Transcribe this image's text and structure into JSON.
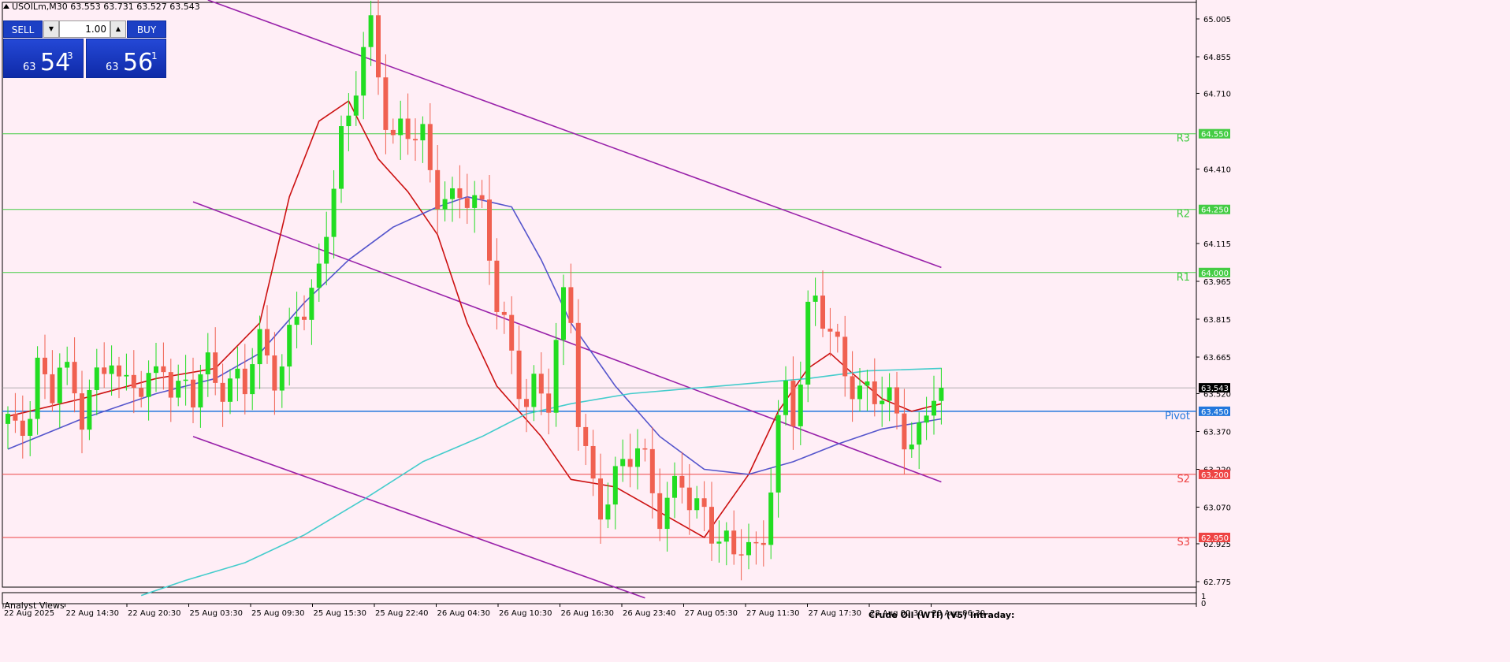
{
  "header": {
    "symbol": "USOILm",
    "timeframe": "M30",
    "title": "USOILm,M30  63.553 63.731 63.527 63.543"
  },
  "trade_panel": {
    "sell_label": "SELL",
    "buy_label": "BUY",
    "lot": "1.00",
    "sell_price": {
      "big": "63",
      "main": "54",
      "pip": "3"
    },
    "buy_price": {
      "big": "63",
      "main": "56",
      "pip": "1"
    }
  },
  "subwindow": {
    "label": ".Analyst Views",
    "title": "Crude Oil (WTI) (V5) Intraday:",
    "scale_top": "1",
    "scale_bottom": "0"
  },
  "colors": {
    "background": "#ffeef6",
    "bull": "#22dd22",
    "bear": "#f06050",
    "resistance": "#44cc44",
    "support": "#ee4444",
    "pivot": "#2277dd",
    "ma_fast": "#cc1111",
    "ma_mid": "#5555cc",
    "ma_slow": "#44cccc",
    "channel": "#9922aa"
  },
  "chart_data": {
    "type": "candlestick",
    "symbol": "USOILm",
    "timeframe": "M30",
    "ylim": [
      62.7,
      65.08
    ],
    "y_ticks": [
      65.005,
      64.855,
      64.71,
      64.41,
      64.115,
      63.965,
      63.815,
      63.665,
      63.52,
      63.37,
      63.22,
      63.07,
      62.925,
      62.775
    ],
    "x_ticks": [
      "22 Aug 2025",
      "22 Aug 14:30",
      "22 Aug 20:30",
      "25 Aug 03:30",
      "25 Aug 09:30",
      "25 Aug 15:30",
      "25 Aug 22:40",
      "26 Aug 04:30",
      "26 Aug 10:30",
      "26 Aug 16:30",
      "26 Aug 23:40",
      "27 Aug 05:30",
      "27 Aug 11:30",
      "27 Aug 17:30",
      "28 Aug 00:30",
      "28 Aug 06:30"
    ],
    "levels": [
      {
        "name": "R3",
        "value": 64.55,
        "label": "64.550"
      },
      {
        "name": "R2",
        "value": 64.25,
        "label": "64.250"
      },
      {
        "name": "R1",
        "value": 64.0,
        "label": "64.000"
      },
      {
        "name": "Pivot",
        "value": 63.45,
        "label": "63.450"
      },
      {
        "name": "S2",
        "value": 63.2,
        "label": "63.200"
      },
      {
        "name": "S3",
        "value": 62.95,
        "label": "62.950"
      }
    ],
    "current_price": 63.543,
    "current_price_label": "63.543",
    "anchors": [
      63.4,
      63.3,
      63.48,
      63.7,
      63.45,
      63.62,
      63.55,
      63.45,
      63.6,
      63.55,
      63.65,
      63.5,
      63.62,
      63.58,
      63.55,
      63.62,
      63.45,
      63.62,
      63.55,
      63.62,
      63.55,
      63.5,
      63.62,
      63.6,
      63.72,
      63.62,
      63.55,
      63.75,
      63.9,
      63.85,
      63.95,
      64.25,
      64.55,
      64.65,
      64.85,
      64.92,
      64.7,
      64.55,
      64.6,
      64.55,
      64.5,
      64.3,
      64.35,
      64.3,
      64.3,
      64.25,
      64.2,
      63.95,
      63.8,
      63.55,
      63.45,
      63.55,
      63.5,
      63.8,
      63.95,
      63.4,
      63.2,
      63.1,
      63.15,
      63.2,
      63.25,
      63.3,
      63.2,
      63.05,
      63.1,
      63.15,
      63.05,
      63.1,
      63.0,
      62.9,
      62.85,
      62.95,
      62.9,
      63.0,
      63.3,
      63.5,
      63.4,
      63.85,
      63.95,
      63.75,
      63.65,
      63.58,
      63.55,
      63.56,
      63.5,
      63.45,
      63.4,
      63.35,
      63.38,
      63.5,
      63.543
    ],
    "moving_averages": [
      {
        "color": "#cc1111",
        "points": [
          [
            0,
            63.43
          ],
          [
            10,
            63.5
          ],
          [
            20,
            63.58
          ],
          [
            28,
            63.62
          ],
          [
            34,
            63.8
          ],
          [
            38,
            64.3
          ],
          [
            42,
            64.6
          ],
          [
            46,
            64.68
          ],
          [
            50,
            64.45
          ],
          [
            54,
            64.32
          ],
          [
            58,
            64.15
          ],
          [
            62,
            63.8
          ],
          [
            66,
            63.55
          ],
          [
            72,
            63.35
          ],
          [
            76,
            63.18
          ],
          [
            82,
            63.15
          ],
          [
            88,
            63.05
          ],
          [
            94,
            62.95
          ],
          [
            100,
            63.2
          ],
          [
            104,
            63.45
          ],
          [
            108,
            63.62
          ],
          [
            111,
            63.68
          ],
          [
            114,
            63.6
          ],
          [
            118,
            63.5
          ],
          [
            122,
            63.45
          ],
          [
            126,
            63.48
          ]
        ]
      },
      {
        "color": "#5555cc",
        "points": [
          [
            0,
            63.3
          ],
          [
            10,
            63.42
          ],
          [
            20,
            63.52
          ],
          [
            28,
            63.58
          ],
          [
            34,
            63.68
          ],
          [
            40,
            63.88
          ],
          [
            46,
            64.05
          ],
          [
            52,
            64.18
          ],
          [
            58,
            64.26
          ],
          [
            62,
            64.3
          ],
          [
            68,
            64.26
          ],
          [
            72,
            64.05
          ],
          [
            76,
            63.8
          ],
          [
            82,
            63.55
          ],
          [
            88,
            63.35
          ],
          [
            94,
            63.22
          ],
          [
            100,
            63.2
          ],
          [
            106,
            63.25
          ],
          [
            112,
            63.32
          ],
          [
            118,
            63.38
          ],
          [
            126,
            63.42
          ]
        ]
      },
      {
        "color": "#44cccc",
        "points": [
          [
            18,
            62.72
          ],
          [
            24,
            62.78
          ],
          [
            32,
            62.85
          ],
          [
            40,
            62.96
          ],
          [
            48,
            63.1
          ],
          [
            56,
            63.25
          ],
          [
            64,
            63.35
          ],
          [
            70,
            63.44
          ],
          [
            76,
            63.48
          ],
          [
            84,
            63.52
          ],
          [
            92,
            63.54
          ],
          [
            100,
            63.56
          ],
          [
            108,
            63.58
          ],
          [
            116,
            63.61
          ],
          [
            126,
            63.62
          ]
        ]
      }
    ],
    "channel_lines": [
      {
        "from": [
          27,
          65.08
        ],
        "to": [
          126,
          64.02
        ]
      },
      {
        "from": [
          25,
          64.28
        ],
        "to": [
          126,
          63.17
        ]
      },
      {
        "from": [
          25,
          63.35
        ],
        "to": [
          86,
          62.71
        ]
      }
    ]
  }
}
